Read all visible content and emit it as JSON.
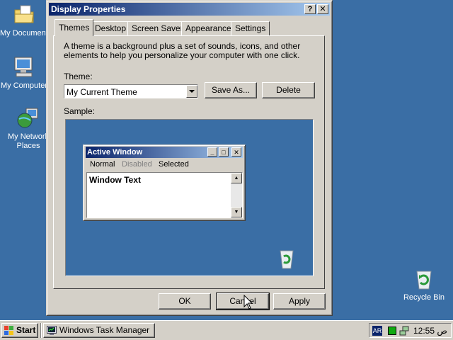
{
  "desktop": {
    "icons": [
      {
        "label": "My Documents",
        "icon": "folder-documents-icon"
      },
      {
        "label": "My Computer",
        "icon": "computer-icon"
      },
      {
        "label": "My Network Places",
        "line1": "My Network",
        "line2": "Places",
        "icon": "network-globe-icon"
      },
      {
        "label": "Recycle Bin",
        "icon": "recycle-bin-icon"
      }
    ]
  },
  "dialog": {
    "title": "Display Properties",
    "help_btn": "?",
    "close_btn": "✕",
    "tabs": [
      "Themes",
      "Desktop",
      "Screen Saver",
      "Appearance",
      "Settings"
    ],
    "active_tab": "Themes",
    "description": "A theme is a background plus a set of sounds, icons, and other elements to help you personalize your computer with one click.",
    "theme_label": "Theme:",
    "theme_value": "My Current Theme",
    "save_as_label": "Save As...",
    "delete_label": "Delete",
    "sample_label": "Sample:",
    "sample_window": {
      "title": "Active Window",
      "menu": [
        "Normal",
        "Disabled",
        "Selected"
      ],
      "text": "Window Text"
    },
    "ok_label": "OK",
    "cancel_label": "Cancel",
    "apply_label": "Apply"
  },
  "taskbar": {
    "start_label": "Start",
    "task_label": "Windows Task Manager",
    "lang": "AR",
    "clock": "12:55 ص"
  },
  "colors": {
    "desktop_bg": "#3a6ea5",
    "titlebar_start": "#0a246a",
    "titlebar_end": "#a6caf0",
    "face": "#d4d0c8"
  }
}
